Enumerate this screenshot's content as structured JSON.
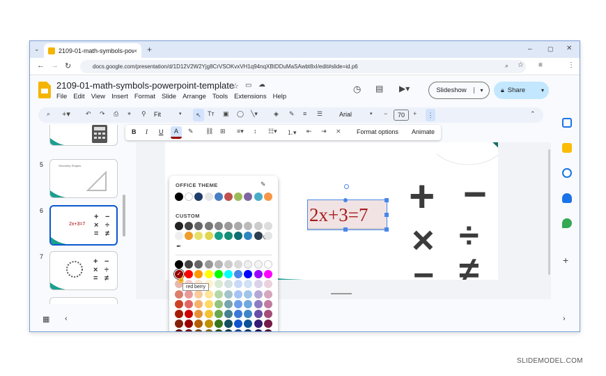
{
  "browser": {
    "tab_title": "2109-01-math-symbols-powerpoint-template",
    "new_tab": "+",
    "url": "docs.google.com/presentation/d/1D12V2W2Yjg8CrVSOKvxVH1q94nqXBtDDuMaSAwbt8xI/edit#slide=id.p6",
    "window_controls": [
      "–",
      "▢",
      "✕"
    ]
  },
  "doc": {
    "title": "2109-01-math-symbols-powerpoint-template",
    "menus": [
      "File",
      "Edit",
      "View",
      "Insert",
      "Format",
      "Slide",
      "Arrange",
      "Tools",
      "Extensions",
      "Help"
    ],
    "slideshow_label": "Slideshow",
    "share_label": "Share"
  },
  "toolbar": {
    "zoom": "Fit",
    "font": "Arial",
    "font_size": "70"
  },
  "format_toolbar": {
    "bold": "B",
    "italic": "I",
    "underline": "U",
    "text_color": "A",
    "format_options": "Format options",
    "animate": "Animate"
  },
  "filmstrip": {
    "slides": [
      {
        "num": "5",
        "label": "Geometry Shapes"
      },
      {
        "num": "6",
        "equation": "2x+3=7",
        "symbols": [
          "+",
          "−",
          "×",
          "÷",
          "=",
          "≠"
        ]
      },
      {
        "num": "7",
        "symbols": [
          "+",
          "−",
          "×",
          "÷",
          "=",
          "≠"
        ]
      }
    ]
  },
  "slide": {
    "equation": "2x+3=7",
    "symbols": [
      "+",
      "−",
      "×",
      "÷",
      "=",
      "≠"
    ]
  },
  "palette": {
    "office_theme_label": "OFFICE THEME",
    "custom_label": "CUSTOM",
    "tooltip": "red berry",
    "theme_colors": [
      "#000000",
      "#ffffff",
      "#1f3d6b",
      "#e7e6e6",
      "#4a7ec2",
      "#c0504d",
      "#9bbb59",
      "#8064a2",
      "#4bacc6",
      "#f79646"
    ],
    "custom_colors": [
      "#222222",
      "#444444",
      "#666666",
      "#777777",
      "#888888",
      "#999999",
      "#aaaaaa",
      "#bbbbbb",
      "#cccccc",
      "#dddddd",
      "#eeeeee",
      "#f09c2b",
      "#e6e06b",
      "#e0d64f",
      "#16a085",
      "#138d75",
      "#0e6e73",
      "#2e86c1",
      "#2c3e50",
      "#e5e5e5"
    ],
    "grid_rows": [
      [
        "#000000",
        "#434343",
        "#666666",
        "#999999",
        "#b7b7b7",
        "#cccccc",
        "#d9d9d9",
        "#efefef",
        "#f3f3f3",
        "#ffffff"
      ],
      [
        "#980000",
        "#ff0000",
        "#ff9900",
        "#ffff00",
        "#00ff00",
        "#00ffff",
        "#4a86e8",
        "#0000ff",
        "#9900ff",
        "#ff00ff"
      ],
      [
        "#e6b8af",
        "#f4cccc",
        "#fce5cd",
        "#fff2cc",
        "#d9ead3",
        "#d0e0e3",
        "#c9daf8",
        "#cfe2f3",
        "#d9d2e9",
        "#ead1dc"
      ],
      [
        "#dd7e6b",
        "#ea9999",
        "#f9cb9c",
        "#ffe599",
        "#b6d7a8",
        "#a2c4c9",
        "#a4c2f4",
        "#9fc5e8",
        "#b4a7d6",
        "#d5a6bd"
      ],
      [
        "#cc4125",
        "#e06666",
        "#f6b26b",
        "#ffd966",
        "#93c47d",
        "#76a5af",
        "#6d9eeb",
        "#6fa8dc",
        "#8e7cc3",
        "#c27ba0"
      ],
      [
        "#a61c00",
        "#cc0000",
        "#e69138",
        "#f1c232",
        "#6aa84f",
        "#45818e",
        "#3c78d8",
        "#3d85c6",
        "#674ea7",
        "#a64d79"
      ],
      [
        "#85200c",
        "#990000",
        "#b45f06",
        "#bf9000",
        "#38761d",
        "#134f5c",
        "#1155cc",
        "#0b5394",
        "#351c75",
        "#741b47"
      ],
      [
        "#5b0f00",
        "#660000",
        "#783f04",
        "#7f6000",
        "#274e13",
        "#0c343d",
        "#1c4587",
        "#073763",
        "#20124d",
        "#4c1130"
      ]
    ]
  },
  "credit": "SLIDEMODEL.COM"
}
